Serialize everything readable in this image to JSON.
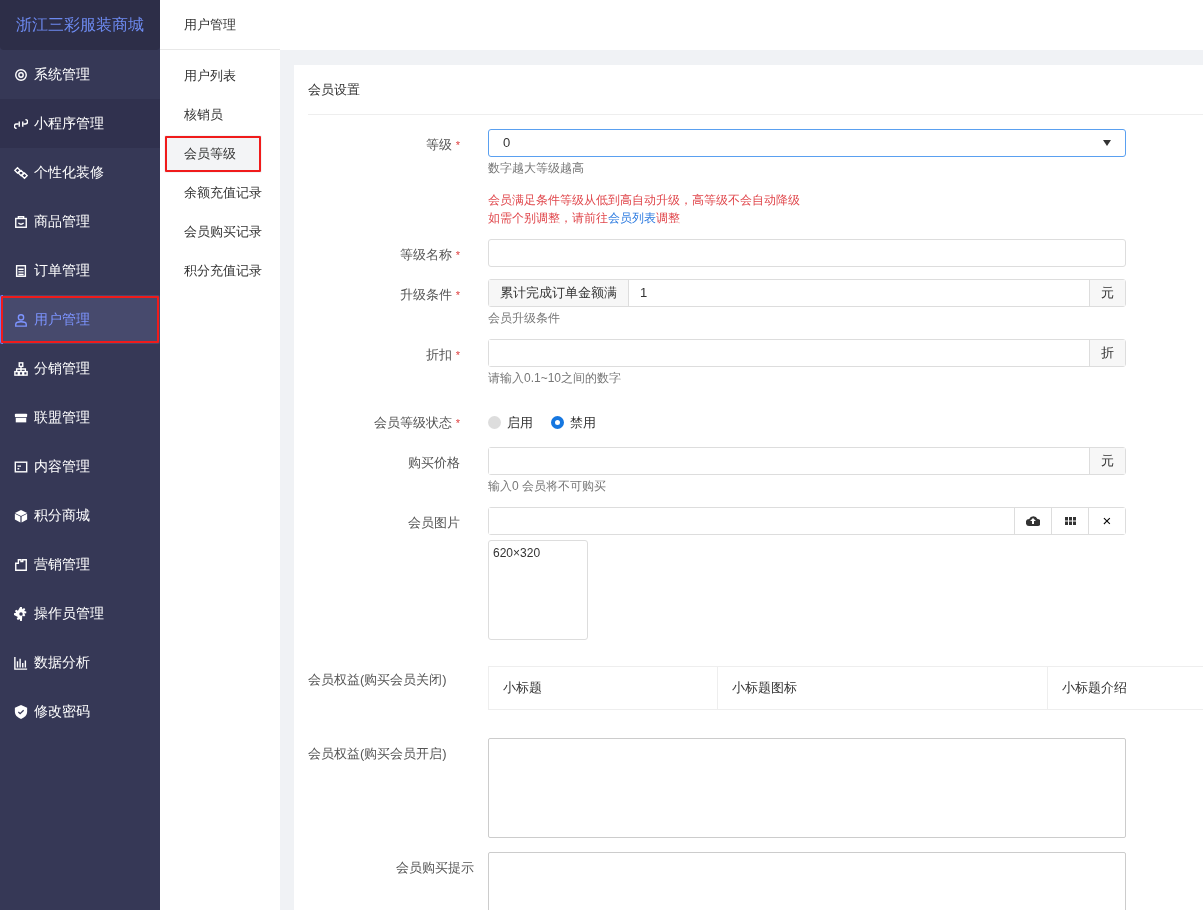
{
  "brand": "浙江三彩服装商城",
  "sidebar": [
    {
      "label": "系统管理",
      "selected": false,
      "annotated": false
    },
    {
      "label": "小程序管理",
      "selected": false,
      "annotated": false
    },
    {
      "label": "个性化装修",
      "selected": false,
      "annotated": false
    },
    {
      "label": "商品管理",
      "selected": false,
      "annotated": false
    },
    {
      "label": "订单管理",
      "selected": false,
      "annotated": false
    },
    {
      "label": "用户管理",
      "selected": true,
      "annotated": true
    },
    {
      "label": "分销管理",
      "selected": false,
      "annotated": false
    },
    {
      "label": "联盟管理",
      "selected": false,
      "annotated": false
    },
    {
      "label": "内容管理",
      "selected": false,
      "annotated": false
    },
    {
      "label": "积分商城",
      "selected": false,
      "annotated": false
    },
    {
      "label": "营销管理",
      "selected": false,
      "annotated": false
    },
    {
      "label": "操作员管理",
      "selected": false,
      "annotated": false
    },
    {
      "label": "数据分析",
      "selected": false,
      "annotated": false
    },
    {
      "label": "修改密码",
      "selected": false,
      "annotated": false
    }
  ],
  "submenu": {
    "title": "用户管理",
    "items": [
      {
        "label": "用户列表",
        "selected": false,
        "annotated": false
      },
      {
        "label": "核销员",
        "selected": false,
        "annotated": false
      },
      {
        "label": "会员等级",
        "selected": true,
        "annotated": true
      },
      {
        "label": "余额充值记录",
        "selected": false,
        "annotated": false
      },
      {
        "label": "会员购买记录",
        "selected": false,
        "annotated": false
      },
      {
        "label": "积分充值记录",
        "selected": false,
        "annotated": false
      }
    ]
  },
  "form": {
    "title": "会员设置",
    "fields": [
      {
        "kind": "select",
        "label": "等级",
        "required_mark": "*",
        "value": "0",
        "help": "数字越大等级越高",
        "notes": [
          "会员满足条件等级从低到高自动升级，高等级不会自动降级",
          {
            "before": "如需个别调整，请前往",
            "link": "会员列表",
            "after": "调整"
          }
        ]
      },
      {
        "kind": "text",
        "label": "等级名称",
        "required_mark": "*"
      },
      {
        "kind": "group",
        "label": "升级条件",
        "required_mark": "*",
        "prefix": "累计完成订单金额满",
        "value": "1",
        "suffix": "元",
        "help": "会员升级条件"
      },
      {
        "kind": "group",
        "label": "折扣",
        "required_mark": "*",
        "suffix": "折",
        "help": "请输入0.1~10之间的数字"
      },
      {
        "kind": "radio",
        "label": "会员等级状态",
        "required_mark": "*",
        "options": [
          {
            "label": "启用",
            "selected": false
          },
          {
            "label": "禁用",
            "selected": true
          }
        ]
      },
      {
        "kind": "group",
        "label": "购买价格",
        "suffix": "元",
        "help": "输入0 会员将不可购买"
      },
      {
        "kind": "upload",
        "label": "会员图片",
        "close": "×",
        "preview": "620×320"
      },
      {
        "kind": "table",
        "label": "会员权益(购买会员关闭)",
        "columns": [
          "小标题",
          "小标题图标",
          "小标题介绍"
        ]
      },
      {
        "kind": "textarea",
        "label": "会员权益(购买会员开启)"
      },
      {
        "kind": "textarea",
        "label": "会员购买提示"
      }
    ]
  }
}
